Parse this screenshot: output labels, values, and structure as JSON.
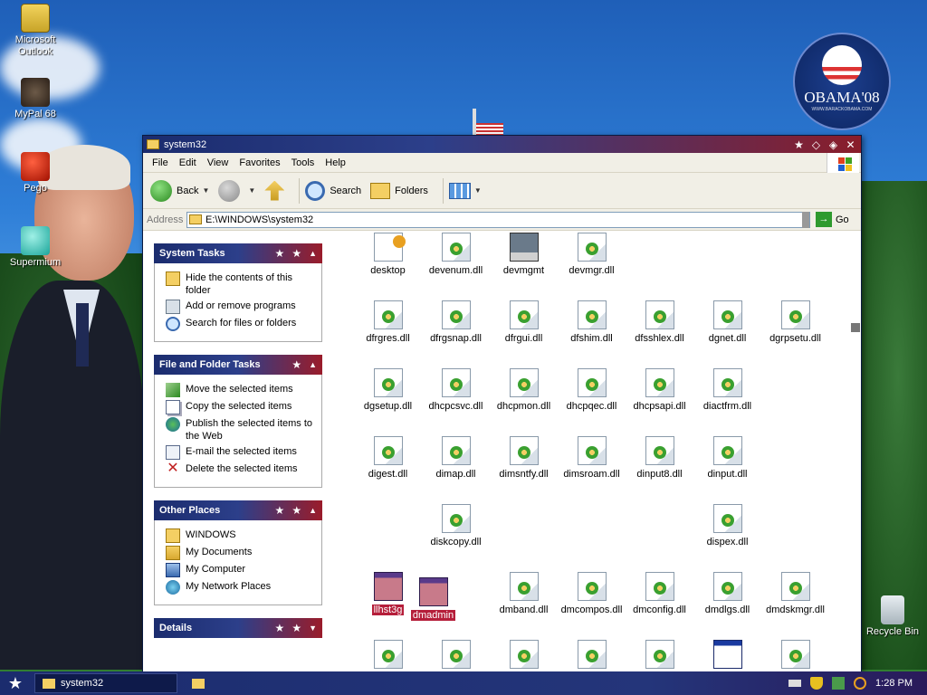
{
  "desktop": {
    "icons": [
      {
        "label": "Microsoft\nOutlook"
      },
      {
        "label": "MyPal 68"
      },
      {
        "label": "Pego"
      },
      {
        "label": "Supermium"
      },
      {
        "label": "Recycle Bin"
      }
    ],
    "logo_text": "OBAMA'08",
    "logo_url": "WWW.BARACKOBAMA.COM"
  },
  "window": {
    "title": "system32",
    "menu": [
      "File",
      "Edit",
      "View",
      "Favorites",
      "Tools",
      "Help"
    ],
    "toolbar": {
      "back": "Back",
      "search": "Search",
      "folders": "Folders"
    },
    "address": {
      "label": "Address",
      "value": "E:\\WINDOWS\\system32",
      "go": "Go"
    },
    "panels": {
      "system_tasks": {
        "title": "System Tasks",
        "items": [
          "Hide the contents of this folder",
          "Add or remove programs",
          "Search for files or folders"
        ]
      },
      "file_tasks": {
        "title": "File and Folder Tasks",
        "items": [
          "Move the selected items",
          "Copy the selected items",
          "Publish the selected items to the Web",
          "E-mail the selected items",
          "Delete the selected items"
        ]
      },
      "other_places": {
        "title": "Other Places",
        "items": [
          "WINDOWS",
          "My Documents",
          "My Computer",
          "My Network Places"
        ]
      },
      "details": {
        "title": "Details"
      }
    },
    "files": [
      {
        "name": "desktop"
      },
      {
        "name": "devenum.dll"
      },
      {
        "name": "devmgmt"
      },
      {
        "name": "devmgr.dll"
      },
      {
        "name": "dfrgres.dll"
      },
      {
        "name": "dfrgsnap.dll"
      },
      {
        "name": "dfrgui.dll"
      },
      {
        "name": "dfshim.dll"
      },
      {
        "name": "dfsshlex.dll"
      },
      {
        "name": "dgnet.dll"
      },
      {
        "name": "dgrpsetu.dll"
      },
      {
        "name": "dgsetup.dll"
      },
      {
        "name": "dhcpcsvc.dll"
      },
      {
        "name": "dhcpmon.dll"
      },
      {
        "name": "dhcpqec.dll"
      },
      {
        "name": "dhcpsapi.dll"
      },
      {
        "name": "diactfrm.dll"
      },
      {
        "name": "digest.dll"
      },
      {
        "name": "dimap.dll"
      },
      {
        "name": "dimsntfy.dll"
      },
      {
        "name": "dimsroam.dll"
      },
      {
        "name": "dinput8.dll"
      },
      {
        "name": "dinput.dll"
      },
      {
        "name": "diskcopy.dll"
      },
      {
        "name": "dispex.dll"
      },
      {
        "name": "llhst3g"
      },
      {
        "name": "dmadmin"
      },
      {
        "name": "dmband.dll"
      },
      {
        "name": "dmcompos.dll"
      },
      {
        "name": "dmconfig.dll"
      },
      {
        "name": "dmdlgs.dll"
      },
      {
        "name": "dmdskmgr.dll"
      }
    ]
  },
  "taskbar": {
    "task_label": "system32",
    "clock": "1:28 PM"
  }
}
